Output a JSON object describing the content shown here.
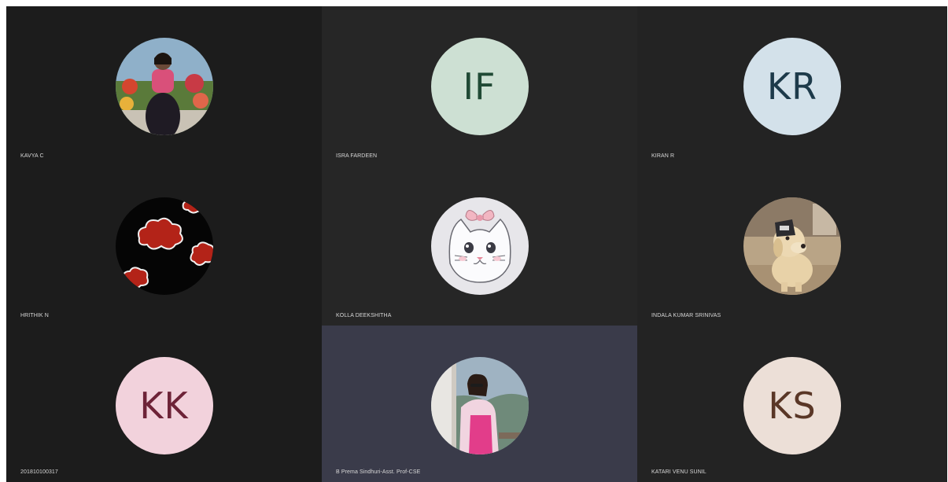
{
  "participants": [
    {
      "name": "KAVYA C",
      "avatar_type": "photo",
      "avatar_icon": "profile-photo-icon"
    },
    {
      "name": "ISRA FARDEEN",
      "avatar_type": "initials",
      "initials": "IF",
      "avatar_bg": "#cde0d3",
      "avatar_fg": "#204a35"
    },
    {
      "name": "KIRAN R",
      "avatar_type": "initials",
      "initials": "KR",
      "avatar_bg": "#d3e1ea",
      "avatar_fg": "#1d3a4a"
    },
    {
      "name": "HRITHIK N",
      "avatar_type": "photo",
      "avatar_icon": "red-cloud-pattern-icon"
    },
    {
      "name": "KOLLA DEEKSHITHA",
      "avatar_type": "photo",
      "avatar_icon": "cartoon-cat-icon"
    },
    {
      "name": "INDALA KUMAR SRINIVAS",
      "avatar_type": "photo",
      "avatar_icon": "dog-statue-icon"
    },
    {
      "name": "201810100317",
      "avatar_type": "initials",
      "initials": "KK",
      "avatar_bg": "#f2d2dc",
      "avatar_fg": "#6e2338"
    },
    {
      "name": "B Prema Sindhuri-Asst. Prof-CSE",
      "avatar_type": "photo",
      "avatar_icon": "profile-photo-icon",
      "active_speaker": true
    },
    {
      "name": "KATARI VENU SUNIL",
      "avatar_type": "initials",
      "initials": "KS",
      "avatar_bg": "#ecdfd7",
      "avatar_fg": "#5a3727"
    }
  ],
  "colors": {
    "tile_bg": "#1f1f1f",
    "active_tile_bg": "#3a3b4a",
    "name_text": "#d8d8d8"
  }
}
